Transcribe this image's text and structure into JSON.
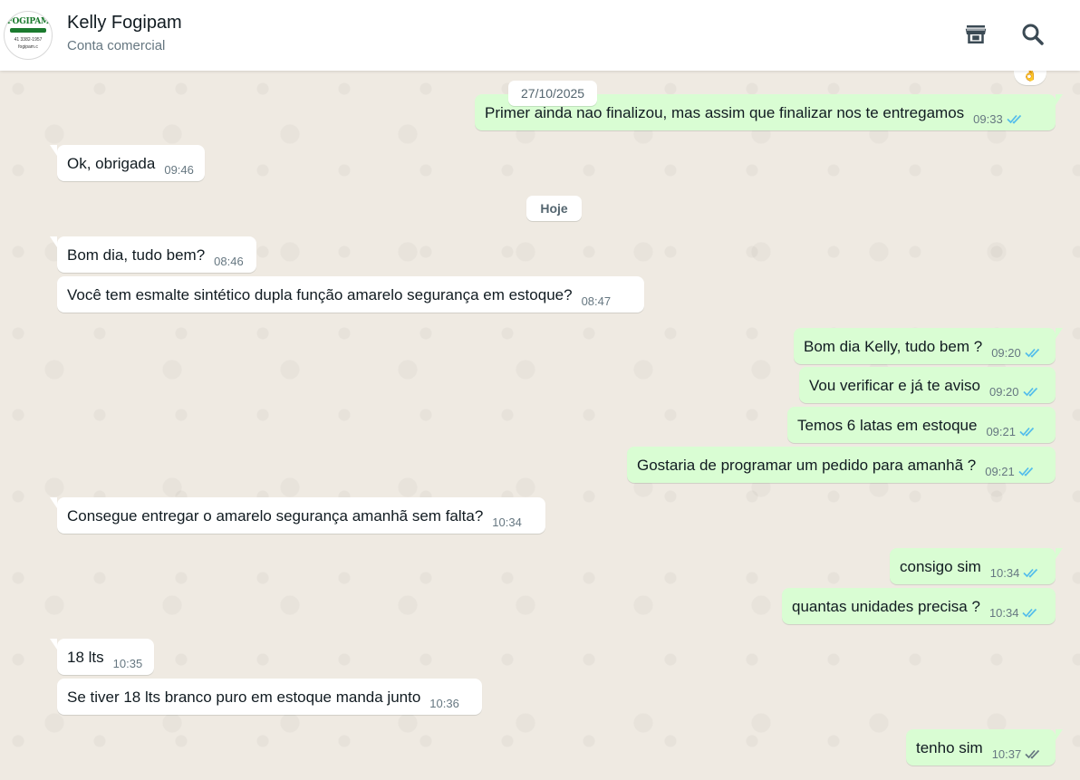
{
  "header": {
    "contact_name": "Kelly Fogipam",
    "contact_subtitle": "Conta comercial",
    "avatar_brand": "FOGIPAM",
    "avatar_phone": "41 3382-1957",
    "avatar_site": "fogipam.c",
    "icons": [
      "store-icon",
      "search-icon"
    ]
  },
  "chat": {
    "reaction_emoji": "👌",
    "date_chips": [
      "27/10/2025",
      "Hoje"
    ],
    "messages": [
      {
        "dir": "out",
        "text": "Primer ainda nao finalizou, mas assim que finalizar nos te entregamos",
        "time": "09:33",
        "status": "read"
      },
      {
        "dir": "in",
        "text": "Ok, obrigada",
        "time": "09:46"
      },
      {
        "dir": "in",
        "text": "Bom dia, tudo bem?",
        "time": "08:46"
      },
      {
        "dir": "in",
        "text": "Você tem esmalte sintético dupla função amarelo segurança em estoque?",
        "time": "08:47"
      },
      {
        "dir": "out",
        "text": "Bom dia Kelly, tudo bem ?",
        "time": "09:20",
        "status": "read"
      },
      {
        "dir": "out",
        "text": "Vou verificar e já te aviso",
        "time": "09:20",
        "status": "read"
      },
      {
        "dir": "out",
        "text": "Temos 6 latas em estoque",
        "time": "09:21",
        "status": "read"
      },
      {
        "dir": "out",
        "text": "Gostaria de programar um pedido para amanhã ?",
        "time": "09:21",
        "status": "read"
      },
      {
        "dir": "in",
        "text": "Consegue entregar o amarelo segurança amanhã sem falta?",
        "time": "10:34"
      },
      {
        "dir": "out",
        "text": "consigo sim",
        "time": "10:34",
        "status": "read"
      },
      {
        "dir": "out",
        "text": "quantas unidades precisa ?",
        "time": "10:34",
        "status": "read"
      },
      {
        "dir": "in",
        "text": "18 lts",
        "time": "10:35"
      },
      {
        "dir": "in",
        "text": "Se tiver 18 lts branco puro em estoque manda junto",
        "time": "10:36"
      },
      {
        "dir": "out",
        "text": "tenho sim",
        "time": "10:37",
        "status": "delivered"
      }
    ]
  },
  "colors": {
    "incoming_bubble": "#ffffff",
    "outgoing_bubble": "#d9fdd3",
    "read_tick": "#53bdeb",
    "delivered_tick": "#667781",
    "chat_background": "#efeae2"
  }
}
